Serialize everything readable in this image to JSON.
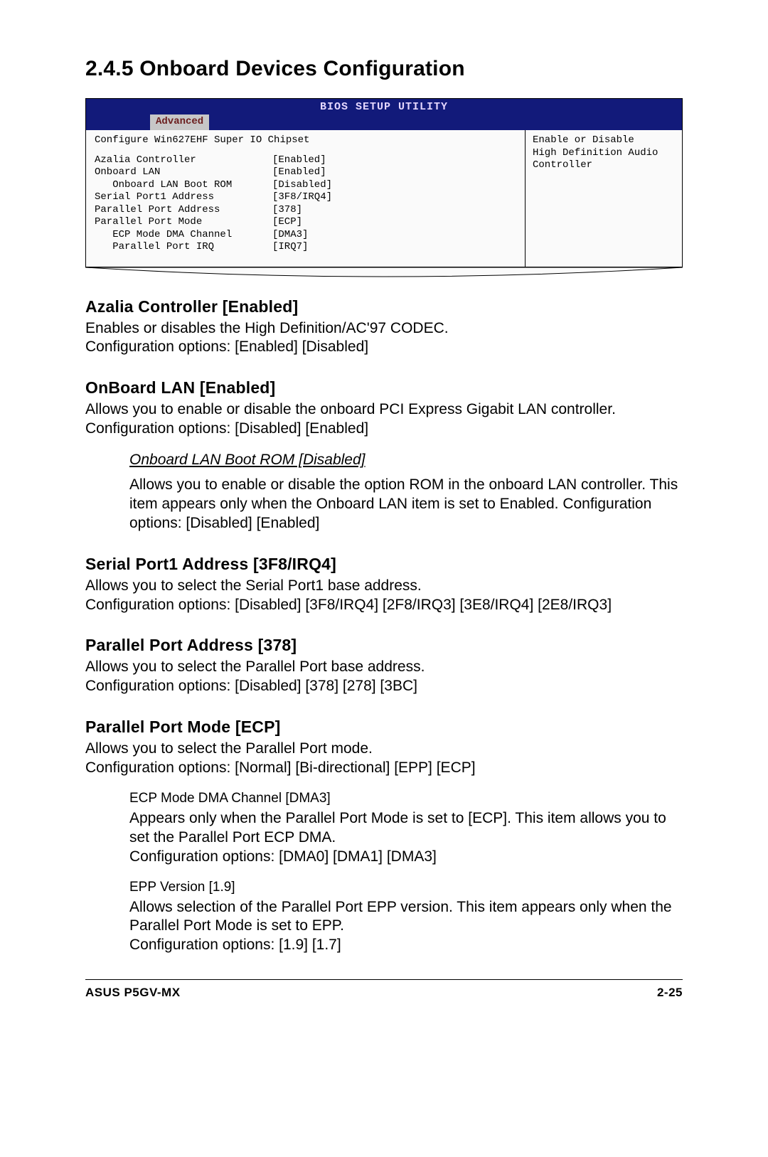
{
  "title": "2.4.5   Onboard Devices Configuration",
  "bios": {
    "header": "BIOS SETUP UTILITY",
    "activeTab": "Advanced",
    "leftHeading": "Configure Win627EHF Super IO Chipset",
    "rows": [
      {
        "label": "Azalia Controller",
        "value": "[Enabled]"
      },
      {
        "label": "Onboard LAN",
        "value": "[Enabled]"
      },
      {
        "label": "   Onboard LAN Boot ROM",
        "value": "[Disabled]"
      },
      {
        "label": "Serial Port1 Address",
        "value": "[3F8/IRQ4]"
      },
      {
        "label": "Parallel Port Address",
        "value": "[378]"
      },
      {
        "label": "Parallel Port Mode",
        "value": "[ECP]"
      },
      {
        "label": "   ECP Mode DMA Channel",
        "value": "[DMA3]"
      },
      {
        "label": "   Parallel Port IRQ",
        "value": "[IRQ7]"
      }
    ],
    "help": "Enable or Disable\nHigh Definition Audio\nController"
  },
  "sections": [
    {
      "head": "Azalia Controller [Enabled]",
      "body": "Enables or disables the High Definition/AC'97 CODEC.\nConfiguration options: [Enabled] [Disabled]"
    },
    {
      "head": "OnBoard LAN [Enabled]",
      "body": "Allows you to enable or disable the onboard PCI Express Gigabit LAN controller. Configuration options: [Disabled] [Enabled]",
      "sub": [
        {
          "style": "underline",
          "head": "Onboard LAN Boot ROM [Disabled]",
          "body": "Allows you to enable or disable the option ROM in the onboard LAN controller. This item appears only when the Onboard LAN item is set to Enabled. Configuration options: [Disabled] [Enabled]"
        }
      ]
    },
    {
      "head": "Serial Port1 Address [3F8/IRQ4]",
      "body": "Allows you to select the Serial Port1 base address.\nConfiguration options: [Disabled] [3F8/IRQ4] [2F8/IRQ3] [3E8/IRQ4] [2E8/IRQ3]"
    },
    {
      "head": "Parallel Port Address [378]",
      "body": "Allows you to select the Parallel Port base address.\nConfiguration options: [Disabled] [378] [278] [3BC]"
    },
    {
      "head": "Parallel Port Mode [ECP]",
      "body": "Allows you to select the Parallel Port mode.\nConfiguration options: [Normal] [Bi-directional] [EPP] [ECP]",
      "sub": [
        {
          "style": "plain",
          "head": "ECP Mode DMA Channel [DMA3]",
          "body": "Appears only when the Parallel Port Mode is set to [ECP]. This item allows you to set the Parallel Port ECP DMA.\nConfiguration options: [DMA0] [DMA1] [DMA3]"
        },
        {
          "style": "plain",
          "head": "EPP Version [1.9]",
          "body": "Allows selection of the Parallel Port EPP version. This item appears only when the Parallel Port Mode is set to EPP.\nConfiguration options: [1.9] [1.7]"
        }
      ]
    }
  ],
  "footer": {
    "left": "ASUS P5GV-MX",
    "right": "2-25"
  }
}
